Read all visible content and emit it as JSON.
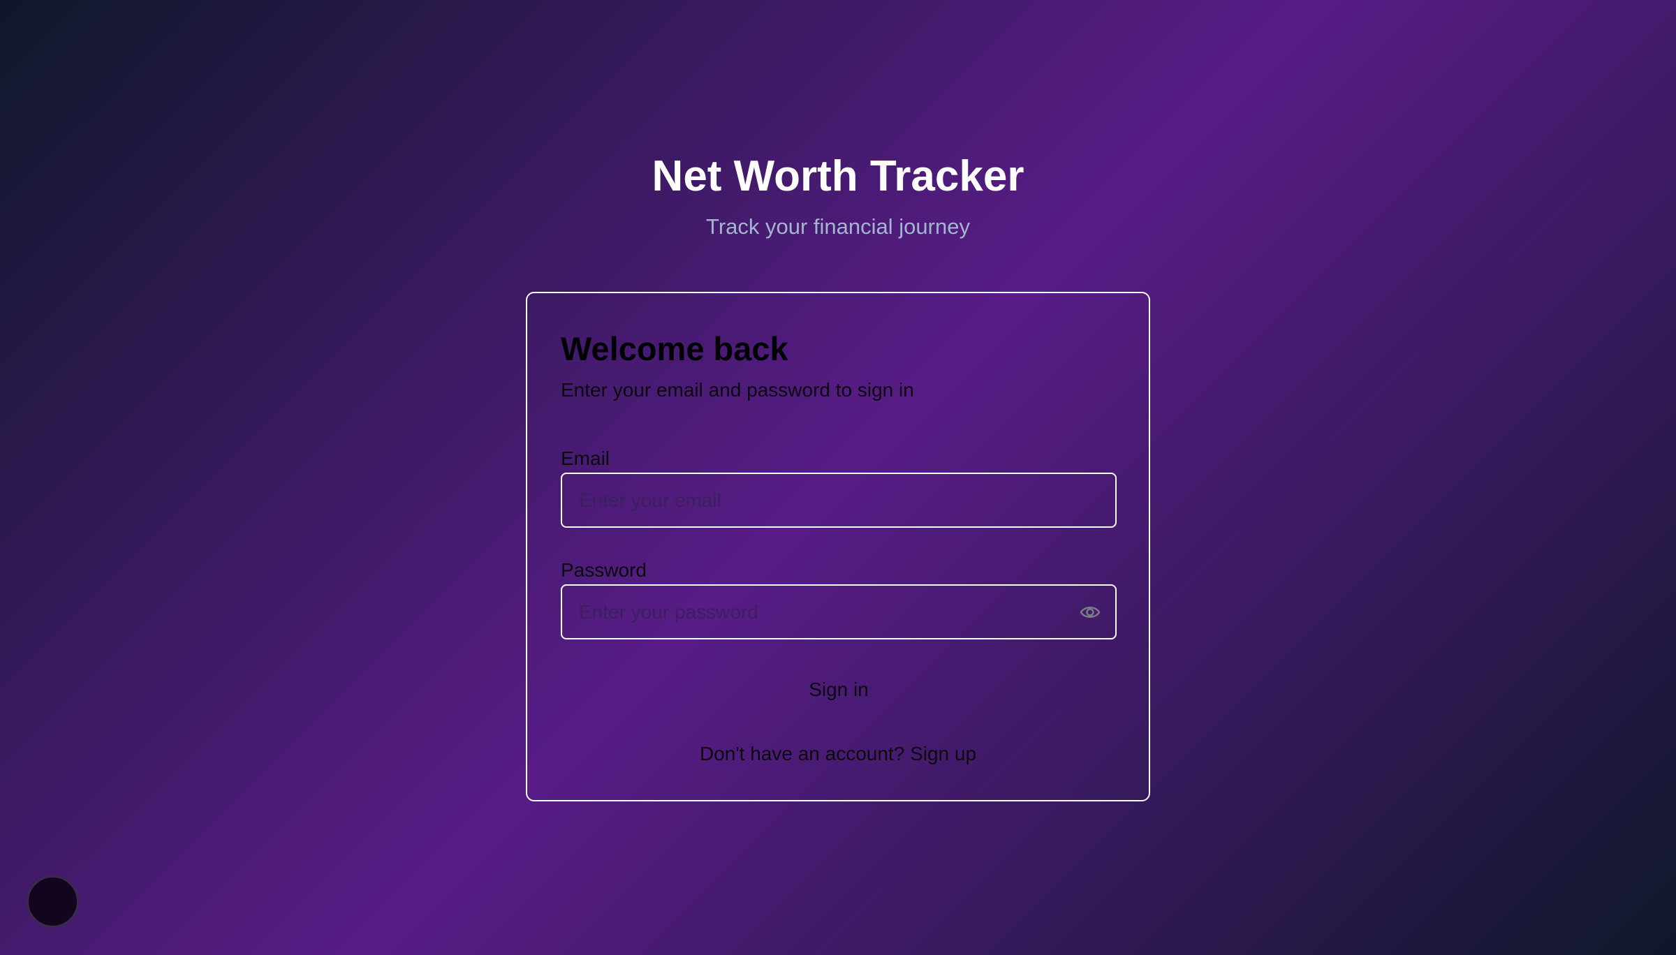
{
  "header": {
    "title": "Net Worth Tracker",
    "subtitle": "Track your financial journey"
  },
  "card": {
    "title": "Welcome back",
    "subtitle": "Enter your email and password to sign in",
    "email": {
      "label": "Email",
      "value": "",
      "placeholder": "Enter your email"
    },
    "password": {
      "label": "Password",
      "value": "",
      "placeholder": "Enter your password",
      "toggle_icon": "eye-icon"
    },
    "submit_label": "Sign in",
    "signup_prompt": "Don't have an account?",
    "signup_link": "Sign up"
  },
  "floating_button": {
    "icon": "circle-avatar"
  },
  "colors": {
    "gradient_dark": "#0f172a",
    "gradient_purple": "#581c87",
    "title": "#ffffff",
    "subtitle": "#a5b4cf",
    "card_border": "#ffffff"
  }
}
